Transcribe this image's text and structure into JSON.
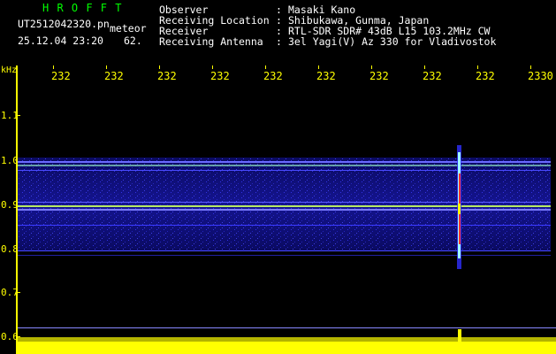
{
  "header": {
    "logo": "H R O F F T",
    "filename": "UT2512042320.pn",
    "kind": "meteor",
    "datetime": "25.12.04 23:20",
    "number": "62."
  },
  "info": {
    "labels": [
      "Observer",
      "Receiving Location",
      "Receiver",
      "Receiving Antenna"
    ],
    "separator": ":",
    "values": [
      "Masaki Kano",
      "Shibukawa, Gunma, Japan",
      "RTL-SDR SDR# 43dB L15 103.2MHz CW",
      "3el Yagi(V) Az 330 for Vladivostok"
    ]
  },
  "axis": {
    "unit": "kHz",
    "time_ticks": [
      "232",
      "232",
      "232",
      "232",
      "232",
      "232",
      "232",
      "232",
      "232",
      "2330"
    ],
    "freq_ticks": [
      "1.1",
      "1.0",
      "0.9",
      "0.8",
      "0.7",
      "0.6"
    ]
  },
  "colors": {
    "header_text": "#ffffff",
    "axis_text": "#ffff00",
    "logo": "#00ff00",
    "band": "#ffff00",
    "signal_band": "#1a1aa0"
  }
}
